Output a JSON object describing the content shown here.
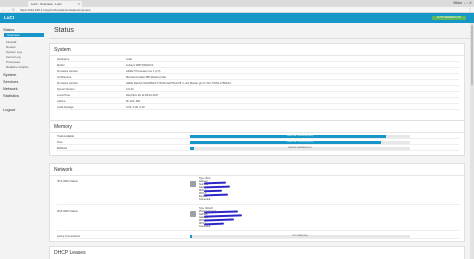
{
  "browser": {
    "tab_title": "LuCI - Overview - LuCI",
    "user": "Viktor",
    "url": "https://192.168.1.1/cgi-bin/luci/admin/status/overview"
  },
  "header": {
    "brand": "LuCI",
    "badge": "AUTO REFRESH ON"
  },
  "sidebar": {
    "status_label": "Status",
    "status_items": [
      "Overview",
      "Firewall",
      "Routes",
      "System Log",
      "Kernel Log",
      "Processes",
      "Realtime Graphs"
    ],
    "active_item": "Overview",
    "menu": [
      "System",
      "Services",
      "Network",
      "Statistics",
      "Logout"
    ]
  },
  "page": {
    "title": "Status"
  },
  "system": {
    "title": "System",
    "rows": [
      {
        "label": "Hostname",
        "value": "Lede"
      },
      {
        "label": "Model",
        "value": "Linksys WRT1900ACS"
      },
      {
        "label": "Firmware Version",
        "value": "ARMv7 Processor rev 1 (v7l)"
      },
      {
        "label": "Architecture",
        "value": "Marvell Armada 385 (Mvebu) Flat"
      },
      {
        "label": "Firmware Version",
        "value": "LEDE Reboot SNAPSHOT r5016-4e67513c78 / LuCI Master git-17.212.77064-c7f50e12"
      },
      {
        "label": "Kernel Version",
        "value": "4.9.44"
      },
      {
        "label": "Local Time",
        "value": "Wed Nov 29 11:09:04 2017"
      },
      {
        "label": "Uptime",
        "value": "0h 22m 38s"
      },
      {
        "label": "Load Average",
        "value": "0.00, 0.00, 0.00"
      }
    ]
  },
  "memory": {
    "title": "Memory",
    "rows": [
      {
        "label": "Total Available",
        "fraction": 0.89,
        "text": "448928 kB / 506260 kB (88%)"
      },
      {
        "label": "Free",
        "fraction": 0.87,
        "text": "440004 kB / 506260 kB (86%)"
      },
      {
        "label": "Buffered",
        "fraction": 0.02,
        "text": "8184 kB / 506260 kB (1%)"
      }
    ]
  },
  "network": {
    "title": "Network",
    "ipv4": {
      "label": "IPv4 WAN Status",
      "lines": [
        "Type: dhcp",
        "Address:",
        "Netmask:",
        "Gateway:",
        "DNS 1:",
        "DNS 2:",
        "Expires:",
        "Connected:"
      ]
    },
    "ipv6": {
      "label": "IPv6 WAN Status",
      "lines": [
        "Type: dhcpv6",
        "Prefix Delegated:",
        "Address:",
        "Gateway:",
        "DNS 1:",
        "DNS 2:",
        "Connected:"
      ]
    },
    "conn": {
      "label": "Active Connections",
      "fraction": 0.01,
      "text": "107 / 16384 (0%)"
    }
  },
  "dhcp": {
    "title": "DHCP Leases"
  },
  "colors": {
    "accent": "#1797c7",
    "badge": "#5cb85c",
    "redaction": "#2f28c8"
  }
}
